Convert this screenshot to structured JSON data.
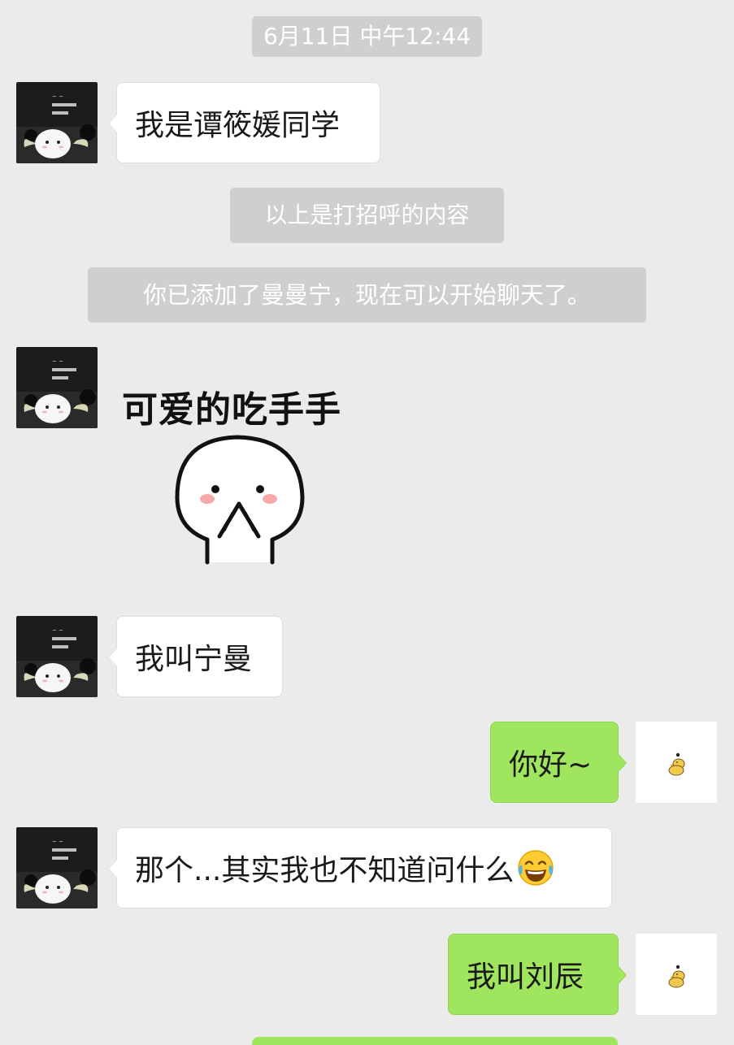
{
  "timestamp": "6月11日 中午12:44",
  "system_messages": {
    "greeting_note": "以上是打招呼的内容",
    "added_note": "你已添加了曼曼宁，现在可以开始聊天了。"
  },
  "messages": [
    {
      "sender": "contact",
      "type": "text",
      "text": "我是谭筱媛同学"
    },
    {
      "sender": "contact",
      "type": "sticker",
      "caption": "可爱的吃手手",
      "icon": "bun-face-sticker"
    },
    {
      "sender": "contact",
      "type": "text",
      "text": "我叫宁曼"
    },
    {
      "sender": "me",
      "type": "text",
      "text": "你好~"
    },
    {
      "sender": "contact",
      "type": "text",
      "text": "那个...其实我也不知道问什么",
      "emoji": "laughing-tears-emoji"
    },
    {
      "sender": "me",
      "type": "text",
      "text": "我叫刘辰"
    }
  ],
  "colors": {
    "background": "#ebebeb",
    "incoming_bubble": "#ffffff",
    "outgoing_bubble": "#9fe65e",
    "system_pill": "#cfcfcf"
  }
}
